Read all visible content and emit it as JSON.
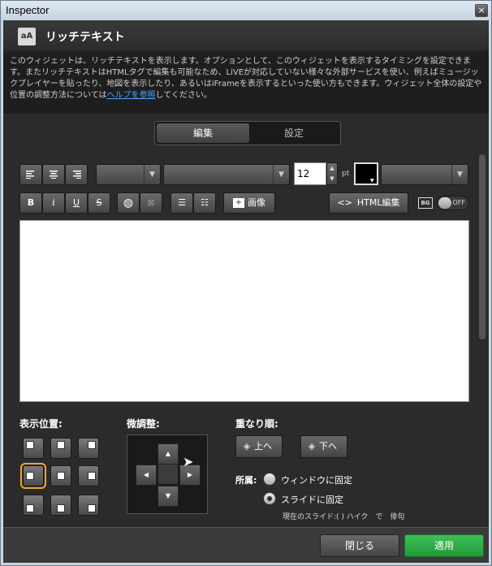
{
  "window": {
    "title": "Inspector",
    "close_glyph": "×"
  },
  "header": {
    "icon_text": "aA",
    "title": "リッチテキスト"
  },
  "description": {
    "text": "このウィジェットは、リッチテキストを表示します。オプションとして、このウィジェットを表示するタイミングを設定できます。またリッチテキストはHTMLタグで編集も可能なため、LiVEが対応していない様々な外部サービスを使い、例えばミュージックプレイヤーを貼ったり、地図を表示したり、あるいはiFrameを表示するといった使い方もできます。ウィジェット全体の設定や位置の調整方法については",
    "link": "ヘルプを参照",
    "suffix": "してください。"
  },
  "tabs": [
    {
      "label": "編集",
      "active": true
    },
    {
      "label": "設定",
      "active": false
    }
  ],
  "toolbar": {
    "font_size": "12",
    "size_unit": "pt",
    "text_color": "#000000",
    "bold": "B",
    "italic": "i",
    "underline": "U",
    "strike": "S",
    "image_label": "画像",
    "html_edit_label": "HTML編集",
    "bg_label": "BG",
    "bg_toggle": "OFF"
  },
  "position": {
    "label": "表示位置:",
    "selected": "middle-left"
  },
  "nudge": {
    "label": "微調整:"
  },
  "order": {
    "label": "重なり順:",
    "up": "上へ",
    "down": "下へ"
  },
  "anchor": {
    "label": "所属:",
    "options": [
      {
        "label": "ウィンドウに固定",
        "selected": false
      },
      {
        "label": "スライドに固定",
        "selected": true
      }
    ],
    "current_slide": "現在のスライド:( ) ハイク　で　俳句"
  },
  "footer": {
    "close": "閉じる",
    "apply": "適用"
  },
  "colors": {
    "accent_selected": "#f5a623",
    "apply_green": "#2fae48",
    "link": "#4da3ff"
  }
}
